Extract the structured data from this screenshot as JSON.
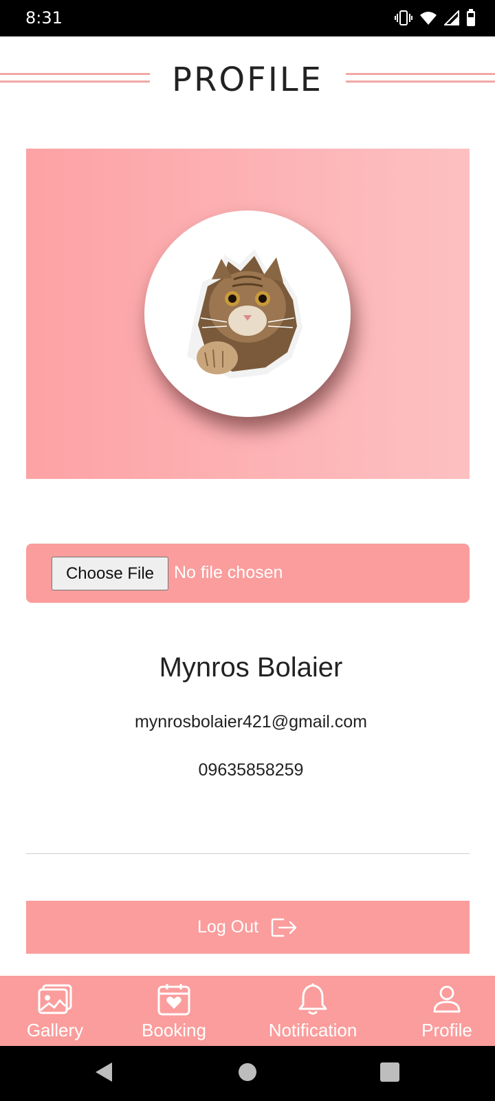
{
  "status_bar": {
    "time": "8:31",
    "icons": [
      "vibrate-icon",
      "wifi-icon",
      "signal-icon",
      "battery-icon"
    ]
  },
  "header": {
    "title": "PROFILE",
    "rule_color": "#f0a9a5"
  },
  "hero": {
    "gradient_from": "#fda2a5",
    "gradient_to": "#fdc0c1",
    "avatar": "cat-peeking-through-paper"
  },
  "file_input": {
    "button_label": "Choose File",
    "status_text": "No file chosen"
  },
  "user": {
    "name": "Mynros Bolaier",
    "email": "mynrosbolaier421@gmail.com",
    "phone": "09635858259"
  },
  "logout": {
    "label": "Log Out",
    "icon": "logout-icon"
  },
  "bottom_nav": {
    "items": [
      {
        "label": "Gallery",
        "icon": "gallery-icon"
      },
      {
        "label": "Booking",
        "icon": "calendar-heart-icon"
      },
      {
        "label": "Notification",
        "icon": "bell-icon"
      },
      {
        "label": "Profile",
        "icon": "person-icon"
      }
    ]
  },
  "android_nav": [
    "back-icon",
    "home-icon",
    "recents-icon"
  ],
  "colors": {
    "accent": "#fa9d9c",
    "text": "#222222",
    "divider": "#cfcfcf"
  }
}
